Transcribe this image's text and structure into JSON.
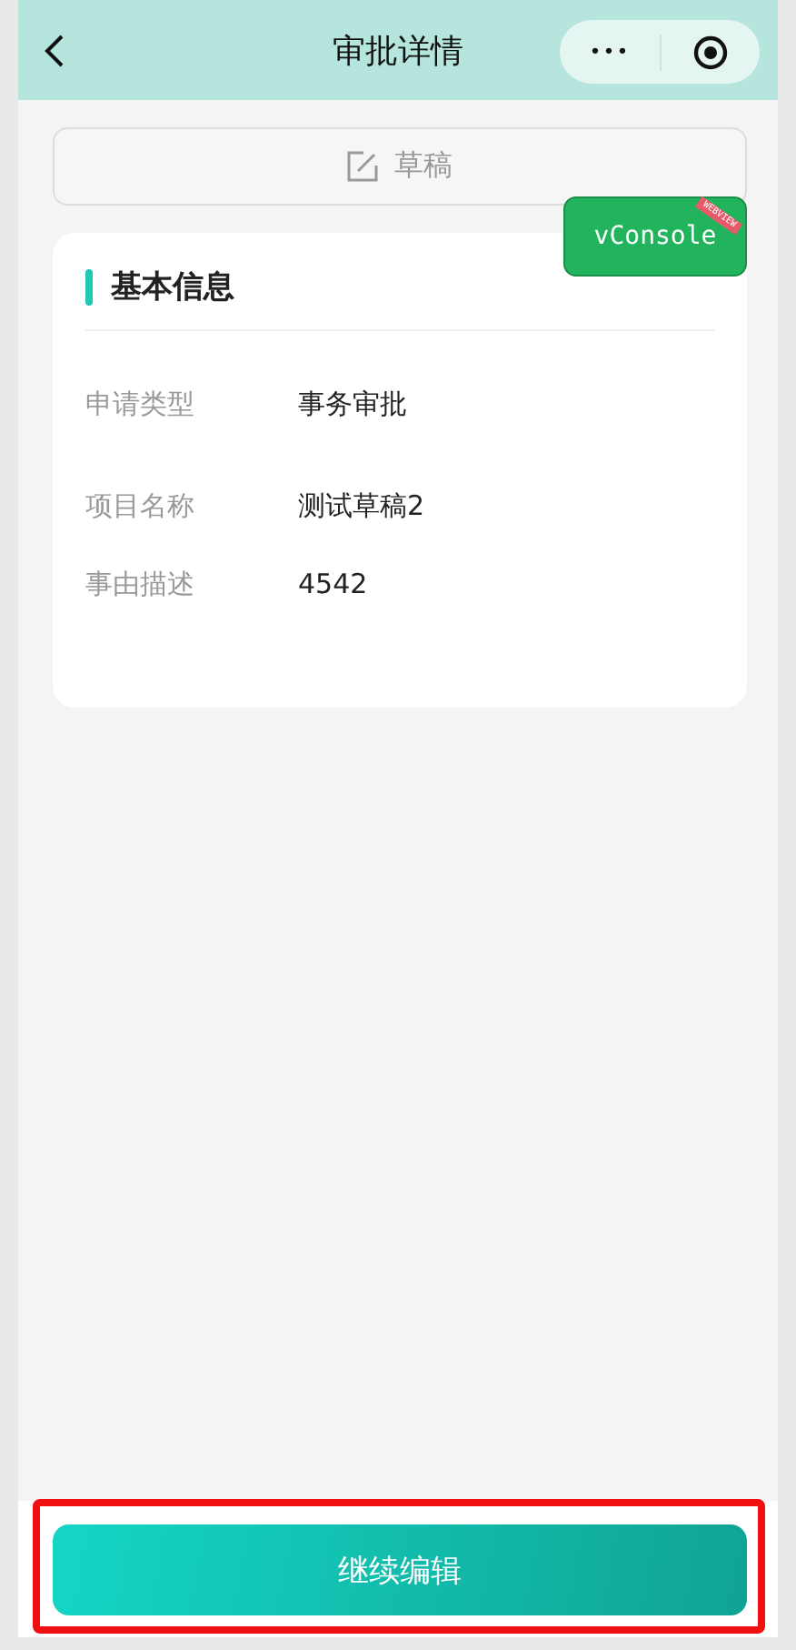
{
  "nav_bar": {
    "title": "审批详情",
    "menu_glyph": "•••"
  },
  "status_button": {
    "label": "草稿"
  },
  "card": {
    "title": "基本信息",
    "fields": [
      {
        "label": "申请类型",
        "value": "事务审批"
      },
      {
        "label": "项目名称",
        "value": "测试草稿2"
      },
      {
        "label": "事由描述",
        "value": "4542"
      }
    ]
  },
  "vconsole": {
    "label": "vConsole",
    "ribbon": "WEBVIEW"
  },
  "footer": {
    "button": "继续编辑",
    "highlighted": true
  }
}
